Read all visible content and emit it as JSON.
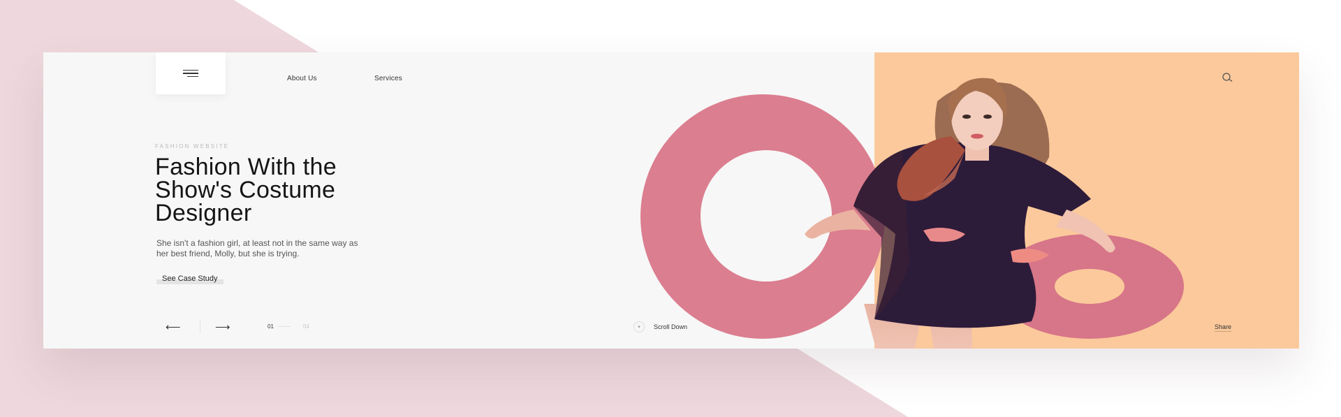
{
  "nav": {
    "menu_icon": "hamburger-menu-icon",
    "links": [
      "About Us",
      "Services"
    ],
    "search_icon": "search-icon"
  },
  "hero": {
    "eyebrow": "FASHION WEBSITE",
    "headline_line1": "Fashion With the",
    "headline_line2": "Show's Costume",
    "headline_line3": "Designer",
    "subcopy_line1": "She isn't a fashion girl, at least not in the same way as",
    "subcopy_line2": "her best friend, Molly, but she is trying.",
    "cta": "See Case Study",
    "image_subject": "model-in-dark-dress-with-pink-rings"
  },
  "pagination": {
    "prev_icon": "arrow-left-icon",
    "next_icon": "arrow-right-icon",
    "current": "01",
    "total": "04"
  },
  "scroll": {
    "icon": "scroll-down-icon",
    "label": "Scroll Down"
  },
  "share": {
    "label": "Share"
  },
  "colors": {
    "background_tint": "#eed8dd",
    "card_bg": "#f7f7f7",
    "accent_peach": "#fbc99b",
    "ring_pink": "#db7e8f",
    "dress_purple": "#2d1b3a",
    "hair_auburn": "#a45a44",
    "text_dark": "#151515"
  }
}
